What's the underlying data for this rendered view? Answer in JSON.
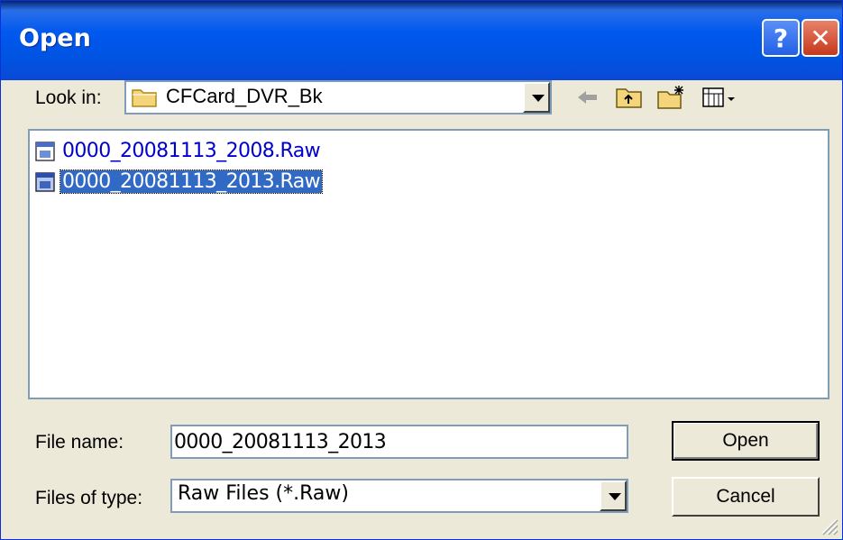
{
  "window": {
    "title": "Open"
  },
  "title_buttons": {
    "help": "?",
    "close": "✕"
  },
  "look_in": {
    "label": "Look in:",
    "value": "CFCard_DVR_Bk"
  },
  "toolbar": {
    "back": "back-arrow",
    "up": "up-folder",
    "new_folder": "new-folder",
    "views": "views-menu"
  },
  "files": [
    {
      "name": "0000_20081113_2008.Raw",
      "selected": false
    },
    {
      "name": "0000_20081113_2013.Raw",
      "selected": true
    }
  ],
  "file_name": {
    "label": "File name:",
    "value": "0000_20081113_2013"
  },
  "file_type": {
    "label": "Files of type:",
    "value": "Raw Files (*.Raw)"
  },
  "buttons": {
    "open": "Open",
    "cancel": "Cancel"
  },
  "colors": {
    "titlebar": "#0054E3",
    "selection": "#316AC5",
    "face": "#ECE9D8",
    "link": "#0000CC"
  }
}
